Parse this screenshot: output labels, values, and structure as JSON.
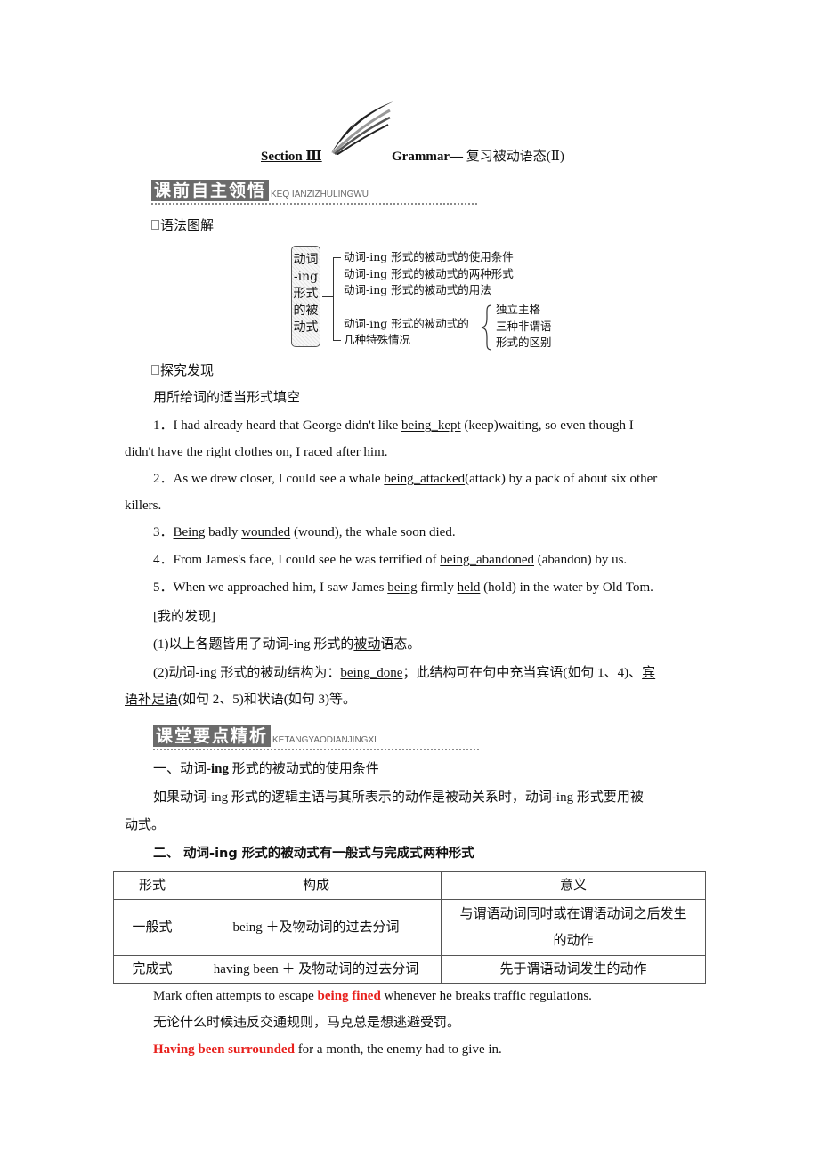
{
  "title": {
    "section": "Section Ⅲ",
    "grammar_bold": "Grammar—",
    "grammar_cn": " 复习被动语态(Ⅱ)"
  },
  "badges": {
    "preview": {
      "label": "课前自主领悟",
      "pinyin": "KEQ IANZIZHULINGWU"
    },
    "focus": {
      "label": "课堂要点精析",
      "pinyin": "KETANGYAODIANJINGXI"
    }
  },
  "grammar_diagram": {
    "heading": "语法图解",
    "root": [
      "动词",
      "-ing",
      "形式",
      "的被",
      "动式"
    ],
    "branches": [
      "动词-ing 形式的被动式的使用条件",
      "动词-ing 形式的被动式的两种形式",
      "动词-ing 形式的被动式的用法"
    ],
    "special_line1": "动词-ing 形式的被动式的",
    "special_line2": "几种特殊情况",
    "special_sub": [
      "独立主格",
      "三种非谓语",
      "形式的区别"
    ]
  },
  "explore": {
    "heading": "探究发现",
    "instruction": "用所给词的适当形式填空",
    "items": [
      {
        "num": "1．",
        "pre": "I had already heard that George didn't like ",
        "ans": "being_kept",
        "post": " (keep)waiting, so even though I",
        "cont": "didn't have the right clothes on, I raced after him."
      },
      {
        "num": "2．",
        "pre": "As we drew closer, I could see a whale ",
        "ans": "being_attacked",
        "post": "(attack) by a pack of about six other",
        "cont": "killers."
      },
      {
        "num": "3．",
        "ans1": "Being",
        "mid": " badly ",
        "ans2": "wounded",
        "post": " (wound), the whale soon died."
      },
      {
        "num": "4．",
        "pre": "From James's face, I could see he was terrified of ",
        "ans": "being_abandoned",
        "post": " (abandon) by us."
      },
      {
        "num": "5．",
        "pre": "When we approached him, I saw James ",
        "ans1": "being",
        "mid": " firmly ",
        "ans2": "held",
        "post": " (hold) in the water by Old Tom."
      }
    ]
  },
  "findings": {
    "heading": "[我的发现]",
    "f1_pre": "(1)以上各题皆用了动词-ing 形式的",
    "f1_ans": "被动",
    "f1_post": "语态。",
    "f2_pre": "(2)动词-ing 形式的被动结构为：",
    "f2_ans": "being_done",
    "f2_mid": "；此结构可在句中充当宾语(如句 1、4)、",
    "f2_ans2a": "宾",
    "f2_ans2b": "语补足语",
    "f2_post": "(如句 2、5)和状语(如句 3)等。"
  },
  "points": {
    "p1_title_a": "一、动词",
    "p1_title_b": "-ing",
    "p1_title_c": " 形式的被动式的使用条件",
    "p1_body_line1": "如果动词-ing 形式的逻辑主语与其所表示的动作是被动关系时，动词-ing 形式要用被",
    "p1_body_line2": "动式。",
    "p2_title": "二、  动词-ing 形式的被动式有一般式与完成式两种形式"
  },
  "table": {
    "headers": [
      "形式",
      "构成",
      "意义"
    ],
    "rows": [
      [
        "一般式",
        "being  ＋及物动词的过去分词",
        "与谓语动词同时或在谓语动词之后发生",
        "的动作"
      ],
      [
        "完成式",
        "having been  ＋  及物动词的过去分词",
        "先于谓语动词发生的动作"
      ]
    ]
  },
  "examples": {
    "e1_pre": "Mark often attempts to escape ",
    "e1_hl": "being fined",
    "e1_post": " whenever he breaks traffic regulations.",
    "e1_cn": "无论什么时候违反交通规则，马克总是想逃避受罚。",
    "e2_hl": "Having been surrounded",
    "e2_post": " for a month, the enemy had to give in."
  },
  "colors": {
    "highlight": "#e8201c",
    "badge": "#6b6b6b"
  }
}
